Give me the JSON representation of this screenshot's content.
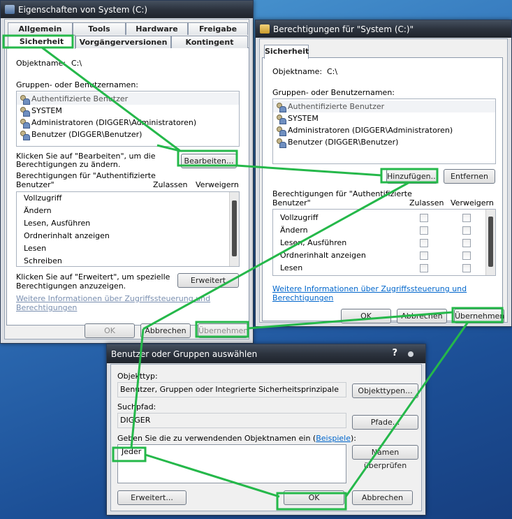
{
  "colors": {
    "highlight": "#25b84a",
    "link": "#0066cc",
    "desktop": "#2f6fb7"
  },
  "icons": {
    "window": "window-icon",
    "folder": "folder-icon",
    "user": "user-group-icon",
    "help": "help-icon",
    "close": "close-icon"
  },
  "w1": {
    "title": "Eigenschaften von System (C:)",
    "tabs": [
      "Allgemein",
      "Tools",
      "Hardware",
      "Freigabe",
      "Sicherheit",
      "Vorgängerversionen",
      "Kontingent"
    ],
    "objname_label": "Objektname:",
    "objname_value": "C:\\",
    "groups_label": "Gruppen- oder Benutzernamen:",
    "users": [
      "Authentifizierte Benutzer",
      "SYSTEM",
      "Administratoren (DIGGER\\Administratoren)",
      "Benutzer (DIGGER\\Benutzer)"
    ],
    "edit_text_1": "Klicken Sie auf \"Bearbeiten\", um die",
    "edit_text_2": "Berechtigungen zu ändern.",
    "edit_button": "Bearbeiten...",
    "perms_for_1": "Berechtigungen für \"Authentifizierte",
    "perms_for_2": "Benutzer\"",
    "allow": "Zulassen",
    "deny": "Verweigern",
    "perms": [
      "Vollzugriff",
      "Ändern",
      "Lesen, Ausführen",
      "Ordnerinhalt anzeigen",
      "Lesen",
      "Schreiben"
    ],
    "adv_text_1": "Klicken Sie auf \"Erweitert\", um spezielle",
    "adv_text_2": "Berechtigungen anzuzeigen.",
    "adv_button": "Erweitert",
    "link": "Weitere Informationen über Zugriffssteuerung und Berechtigungen",
    "ok": "OK",
    "cancel": "Abbrechen",
    "apply": "Übernehmen"
  },
  "w2": {
    "title": "Berechtigungen für \"System (C:)\"",
    "tab": "Sicherheit",
    "objname_label": "Objektname:",
    "objname_value": "C:\\",
    "groups_label": "Gruppen- oder Benutzernamen:",
    "users": [
      "Authentifizierte Benutzer",
      "SYSTEM",
      "Administratoren (DIGGER\\Administratoren)",
      "Benutzer (DIGGER\\Benutzer)"
    ],
    "add_button": "Hinzufügen...",
    "remove_button": "Entfernen",
    "perms_for_1": "Berechtigungen für \"Authentifizierte",
    "perms_for_2": "Benutzer\"",
    "allow": "Zulassen",
    "deny": "Verweigern",
    "perms": [
      "Vollzugriff",
      "Ändern",
      "Lesen, Ausführen",
      "Ordnerinhalt anzeigen",
      "Lesen"
    ],
    "link": "Weitere Informationen über Zugriffssteuerung und Berechtigungen",
    "ok": "OK",
    "cancel": "Abbrechen",
    "apply": "Übernehmen"
  },
  "w3": {
    "title": "Benutzer oder Gruppen auswählen",
    "help": "?",
    "objtype_label": "Objekttyp:",
    "objtype_value": "Benutzer, Gruppen oder Integrierte Sicherheitsprinzipale",
    "objtype_button": "Objekttypen...",
    "path_label": "Suchpfad:",
    "path_value": "DIGGER",
    "path_button": "Pfade...",
    "names_label": "Geben Sie die zu verwendenden Objektnamen ein (",
    "names_link": "Beispiele",
    "names_label_end": "):",
    "names_value": "Jeder",
    "check_button": "Namen überprüfen",
    "adv_button": "Erweitert...",
    "ok": "OK",
    "cancel": "Abbrechen"
  }
}
